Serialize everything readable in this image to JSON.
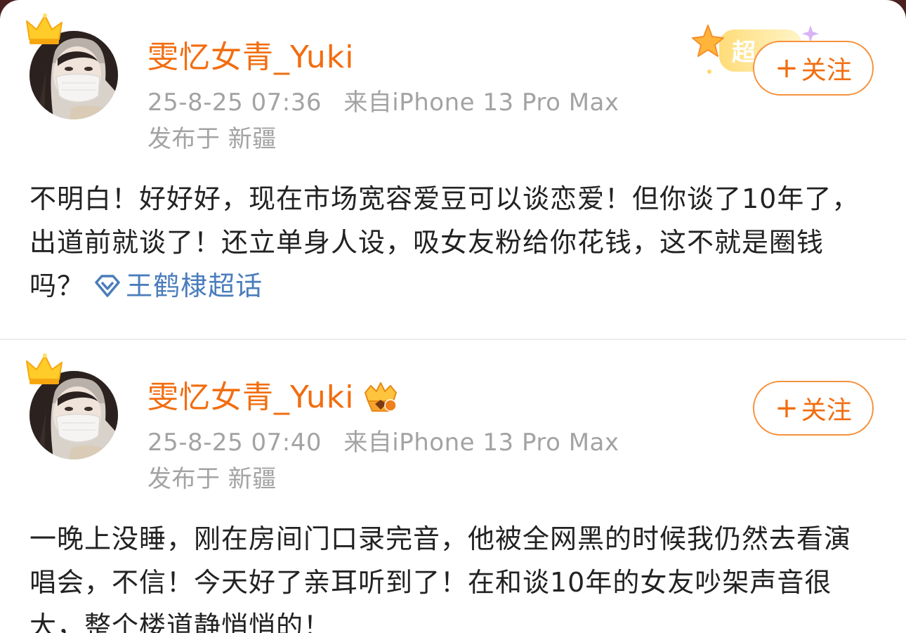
{
  "posts": [
    {
      "username": "雯忆女青_Yuki",
      "time": "25-8-25 07:36",
      "source": "来自iPhone 13 Pro Max",
      "location": "发布于 新疆",
      "follow_label": "关注",
      "follow_plus": "+",
      "super_badge_text": "超",
      "content": "不明白！好好好，现在市场宽容爱豆可以谈恋爱！但你谈了10年了，出道前就谈了！还立单身人设，吸女友粉给你花钱，这不就是圈钱吗？",
      "topic": "王鹤棣超话"
    },
    {
      "username": "雯忆女青_Yuki",
      "time": "25-8-25 07:40",
      "source": "来自iPhone 13 Pro Max",
      "location": "发布于 新疆",
      "follow_label": "关注",
      "follow_plus": "+",
      "content": "一晚上没睡，刚在房间门口录完音，他被全网黑的时候我仍然去看演唱会，不信！今天好了亲耳听到了！在和谈10年的女友吵架声音很大，整个楼道静悄悄的！"
    }
  ],
  "colors": {
    "username": "#f26d0f",
    "follow_border": "#f7913d",
    "meta": "#a3a3a3",
    "text": "#222222",
    "topic": "#4a7dbb"
  },
  "icons": {
    "crown": "crown-icon",
    "fan_badge": "fan-badge-icon",
    "topic": "super-topic-icon"
  }
}
